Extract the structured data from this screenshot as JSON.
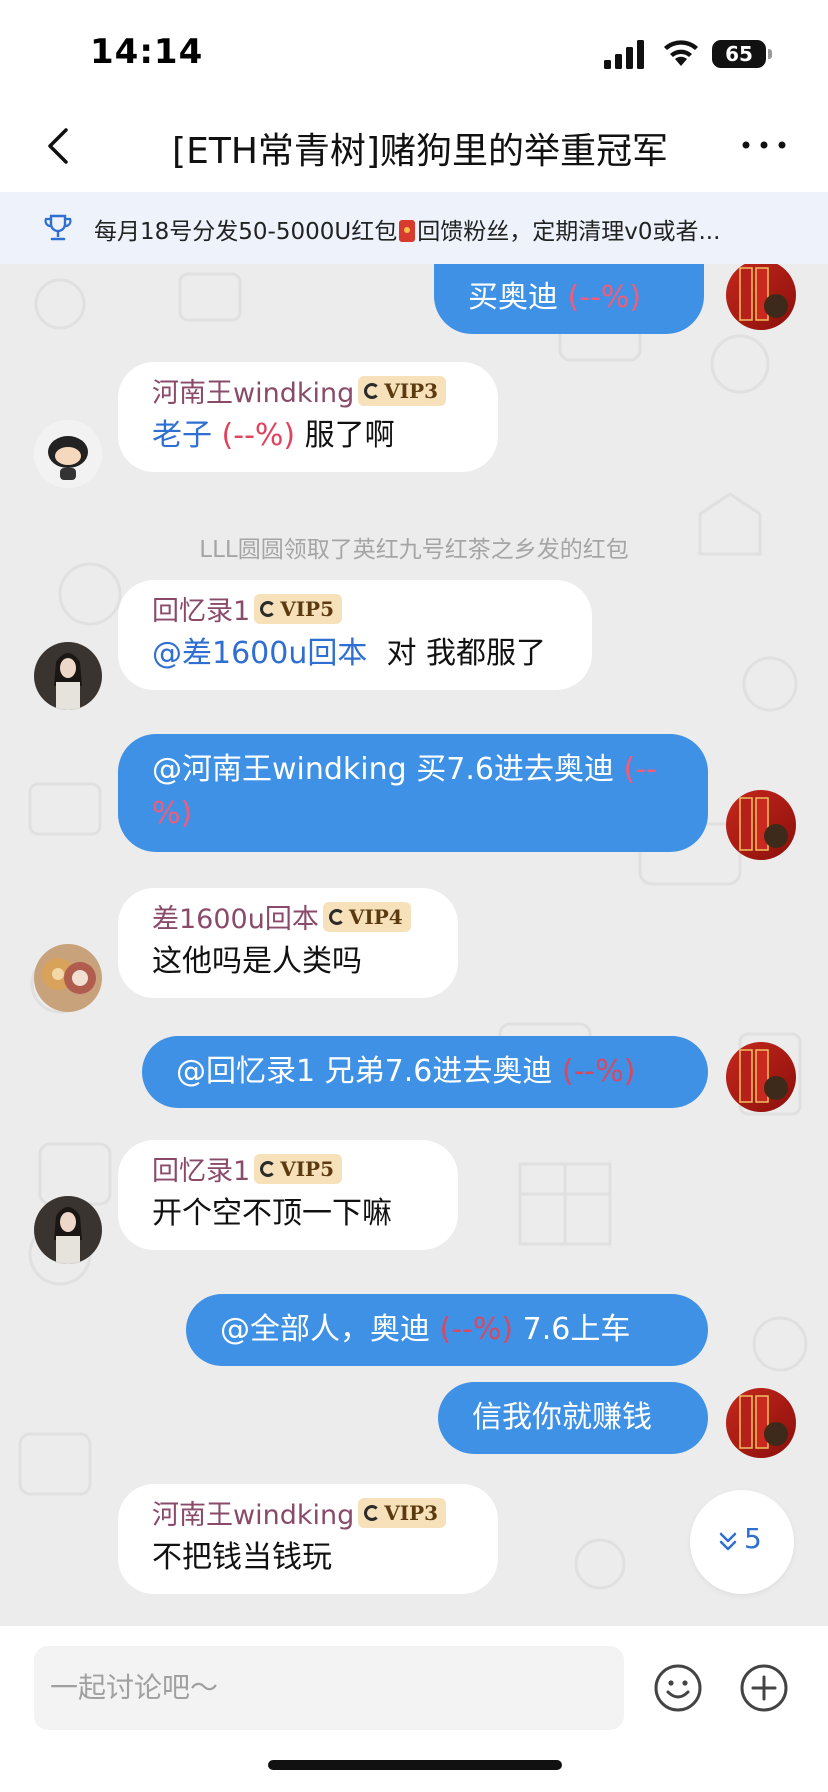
{
  "status_bar": {
    "time": "14:14",
    "battery": "65"
  },
  "header": {
    "title": "[ETH常青树]赌狗里的举重冠军"
  },
  "notice": {
    "text_before": "每月18号分发50-5000U红包",
    "text_after": "回馈粉丝，定期清理v0或者..."
  },
  "messages": {
    "m1": {
      "text": "买奥迪",
      "pct": "(--%)"
    },
    "m2": {
      "sender": "河南王windking",
      "vip": "VIP3",
      "text_blue": "老子",
      "pct": "(--%)",
      "text_after": "服了啊"
    },
    "system": {
      "text": "LLL圆圆领取了英红九号红茶之乡发的红包"
    },
    "m3": {
      "sender": "回忆录1",
      "vip": "VIP5",
      "mention": "@差1600u回本",
      "text_after": "对  我都服了"
    },
    "m4": {
      "text": "@河南王windking 买7.6进去奥迪",
      "pct_a": "(--",
      "pct_b": "%)"
    },
    "m5": {
      "sender": "差1600u回本",
      "vip": "VIP4",
      "text": "这他吗是人类吗"
    },
    "m6": {
      "text": "@回忆录1 兄弟7.6进去奥迪",
      "pct": "(--%)"
    },
    "m7": {
      "sender": "回忆录1",
      "vip": "VIP5",
      "text": "开个空不顶一下嘛"
    },
    "m8": {
      "text_before": "@全部人，奥迪",
      "pct": "(--%)",
      "text_after": "7.6上车"
    },
    "m9": {
      "text": "信我你就赚钱"
    },
    "m10": {
      "sender": "河南王windking",
      "vip": "VIP3",
      "text": "不把钱当钱玩"
    }
  },
  "unread": {
    "count": "5"
  },
  "input": {
    "placeholder": "一起讨论吧～"
  },
  "colors": {
    "out_bubble": "#3f91e6",
    "in_bubble": "#ffffff",
    "chat_bg": "#ececec",
    "accent": "#2f6fd1"
  },
  "icons": [
    "back-icon",
    "more-icon",
    "trophy-icon",
    "emoji-icon",
    "plus-icon",
    "chevron-down-icon"
  ]
}
